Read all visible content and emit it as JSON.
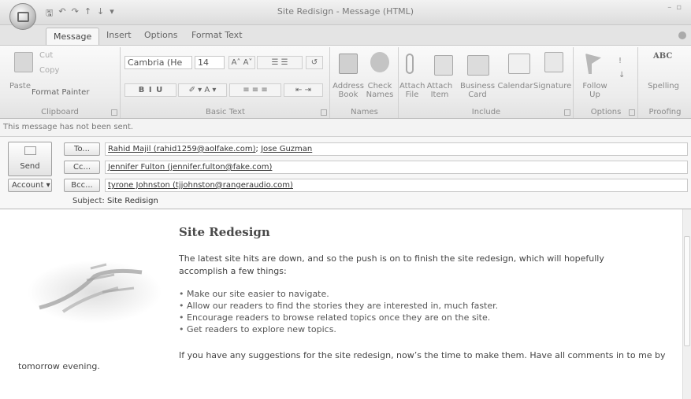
{
  "window": {
    "title": "Site Redisign - Message (HTML)"
  },
  "tabs": [
    "Message",
    "Insert",
    "Options",
    "Format Text"
  ],
  "ribbon": {
    "clipboard": {
      "paste": "Paste",
      "cut": "Cut",
      "copy": "Copy",
      "format_painter": "Format Painter",
      "label": "Clipboard"
    },
    "basic_text": {
      "font": "Cambria (He",
      "size": "14",
      "label": "Basic Text"
    },
    "names": {
      "address_book": "Address Book",
      "check_names": "Check Names",
      "label": "Names"
    },
    "include": {
      "attach_file": "Attach File",
      "attach_item": "Attach Item",
      "business_card": "Business Card",
      "calendar": "Calendar",
      "signature": "Signature",
      "label": "Include"
    },
    "options": {
      "follow_up": "Follow Up",
      "label": "Options"
    },
    "proofing": {
      "spelling": "Spelling",
      "label": "Proofing",
      "abc": "ABC"
    }
  },
  "info_bar": "This message has not been sent.",
  "header": {
    "send": "Send",
    "account": "Account",
    "to_btn": "To...",
    "cc_btn": "Cc...",
    "bcc_btn": "Bcc...",
    "subject_label": "Subject:",
    "to_value_1": "Rahid Majil (rahid1259@aolfake.com)",
    "to_value_2": "Jose Guzman",
    "cc_value": "Jennifer Fulton (jennifer.fulton@fake.com)",
    "bcc_value": "tyrone Johnston (tjjohnston@rangeraudio.com)",
    "subject_value": "Site Redisign"
  },
  "body": {
    "heading": "Site Redesign",
    "paragraph": "The latest site hits are down, and so the push is on to finish the site redesign, which will hopefully accomplish a few things:",
    "bullets": [
      "Make our site easier to navigate.",
      "Allow our readers to find the stories they are interested in, much faster.",
      "Encourage readers to browse related topics once they are on the site.",
      "Get readers to explore new topics."
    ],
    "closing_1": "If you have any suggestions for the site redesign, now’s the time to make them. Have all comments in to me by",
    "closing_2": "tomorrow evening."
  }
}
